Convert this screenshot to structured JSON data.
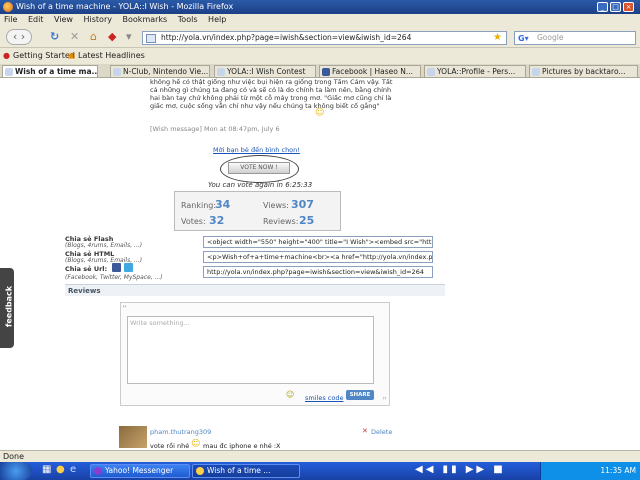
{
  "window": {
    "title": "Wish of a time machine - YOLA::I Wish - Mozilla Firefox"
  },
  "menu": [
    "File",
    "Edit",
    "View",
    "History",
    "Bookmarks",
    "Tools",
    "Help"
  ],
  "url": "http://yola.vn/index.php?page=iwish&section=view&iwish_id=264",
  "search_placeholder": "Google",
  "bookmarks": {
    "getting_started": "Getting Started",
    "latest_headlines": "Latest Headlines"
  },
  "tabs": [
    "Wish of a time ma...",
    "N-Club, Nintendo Vie...",
    "YOLA::I Wish Contest",
    "Facebook | Haseo N...",
    "YOLA::Profile - Pers...",
    "Pictures by backtaro..."
  ],
  "wish": {
    "text": "không hề có thật giống như việc bụi hiện ra giống trong Tấm Cám vậy. Tất cả những gì chúng ta đang có và sẽ có là do chính ta làm nên, bằng chính hai bàn tay chứ không phải từ một cỗ máy trong mơ. \"Giấc mơ cũng chỉ là giấc mơ, cuộc sống vẫn chỉ như vậy nếu chúng ta không biết cố gắng\"",
    "meta": "[Wish message] Mon at 08:47pm, July 6"
  },
  "vote": {
    "invite_link": "Mời bạn bè đến bình chọn!",
    "button": "VOTE NOW !",
    "again": "You can vote again in 6:25:33"
  },
  "stats": {
    "ranking_label": "Ranking:",
    "ranking": "34",
    "views_label": "Views:",
    "views": "307",
    "votes_label": "Votes:",
    "votes": "32",
    "reviews_label": "Reviews:",
    "reviews": "25"
  },
  "share": {
    "flash_label": "Chia sẻ Flash",
    "flash_sub": "(Blogs, 4rums, Emails, ...)",
    "flash_code": "<object width=\"550\" height=\"400\" title=\"I Wish\"><embed src=\"http://yol",
    "html_label": "Chia sẻ HTML",
    "html_sub": "(Blogs, 4rums, Emails, ...)",
    "html_code": "<p>Wish+of+a+time+machine<br><a href=\"http://yola.vn/index.php?p",
    "url_label": "Chia sẻ Url:",
    "url_sub": "(Facebook, Twitter, MySpace, ...)",
    "url_code": "http://yola.vn/index.php?page=iwish&section=view&iwish_id=264"
  },
  "reviews": {
    "header": "Reviews",
    "placeholder": "Write something...",
    "smiles": "smiles code",
    "share_button": "SHARE"
  },
  "comment": {
    "author": "pham.thutrang309",
    "delete": "Delete",
    "line1": "vote rồi nhé",
    "line2": "mau đc iphone e nhé :X"
  },
  "feedback": "feedback",
  "status": "Done",
  "taskbar": {
    "items": [
      "Yahoo! Messenger",
      "Wish of a time ..."
    ],
    "clock": "11:35 AM"
  }
}
